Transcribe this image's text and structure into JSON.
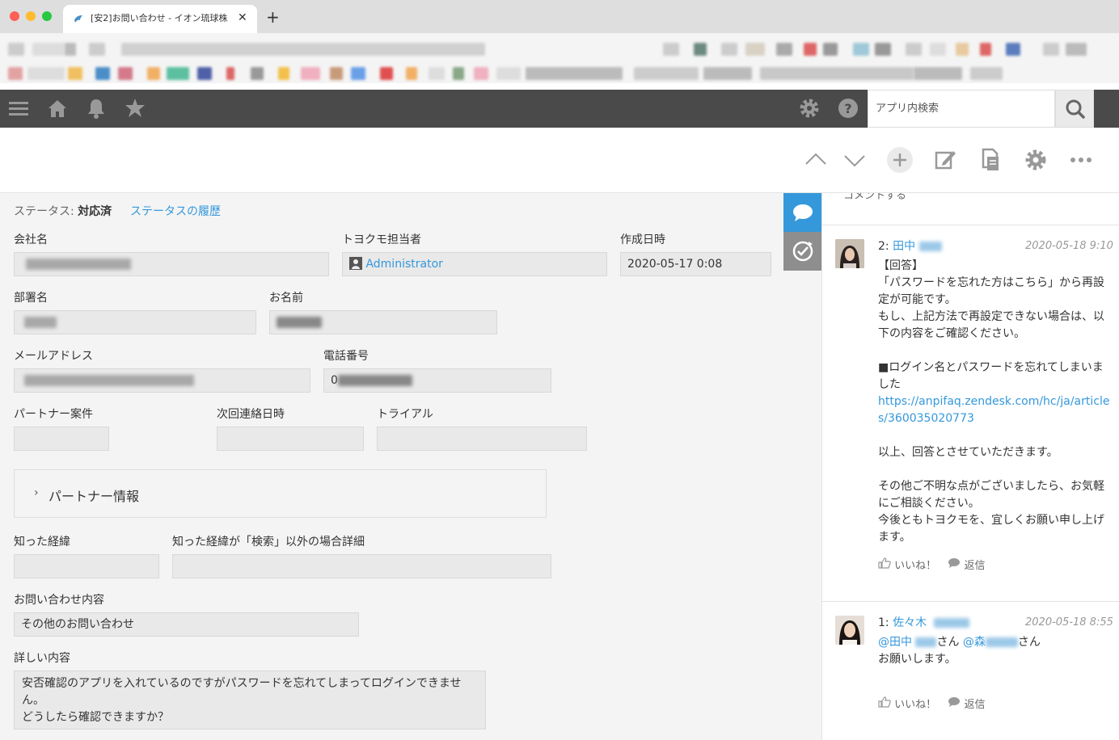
{
  "browser": {
    "tab_title": "[安2]お問い合わせ - イオン琉球株",
    "tab_close": "✕",
    "new_tab": "+"
  },
  "header": {
    "search_placeholder": "アプリ内検索"
  },
  "record": {
    "status_label": "ステータス:",
    "status_value": "対応済",
    "status_history": "ステータスの履歴",
    "fields": {
      "company": {
        "label": "会社名",
        "value": ""
      },
      "owner": {
        "label": "トヨクモ担当者",
        "value": "Administrator"
      },
      "created": {
        "label": "作成日時",
        "value": "2020-05-17 0:08"
      },
      "department": {
        "label": "部署名",
        "value": ""
      },
      "name": {
        "label": "お名前",
        "value": ""
      },
      "email": {
        "label": "メールアドレス",
        "value": ""
      },
      "phone": {
        "label": "電話番号",
        "value": "0"
      },
      "partner_case": {
        "label": "パートナー案件",
        "value": ""
      },
      "next_contact": {
        "label": "次回連絡日時",
        "value": ""
      },
      "trial": {
        "label": "トライアル",
        "value": ""
      },
      "referral": {
        "label": "知った経緯",
        "value": ""
      },
      "referral_detail": {
        "label": "知った経緯が「検索」以外の場合詳細",
        "value": ""
      },
      "inquiry_type": {
        "label": "お問い合わせ内容",
        "value": "その他のお問い合わせ"
      },
      "details": {
        "label": "詳しい内容",
        "lines": [
          "安否確認のアプリを入れているのですがパスワードを忘れてしまってログインできませ",
          "ん。",
          "どうしたら確認できますか？"
        ]
      }
    },
    "partner_group_title": "パートナー情報",
    "partner_group_chevron": "›"
  },
  "comments": {
    "input_placeholder": "コメントする",
    "items": [
      {
        "num": "2:",
        "author": "田中",
        "date": "2020-05-18 9:10",
        "lines": [
          "【回答】",
          "「パスワードを忘れた方はこちら」から再設定が可能です。",
          "もし、上記方法で再設定できない場合は、以下の内容をご確認ください。",
          "",
          "■ログイン名とパスワードを忘れてしまいました"
        ],
        "link": "https://anpifaq.zendesk.com/hc/ja/articles/360035020773",
        "lines_after": [
          "",
          "以上、回答とさせていただきます。",
          "",
          "その他ご不明な点がございましたら、お気軽にご相談ください。",
          "今後ともトヨクモを、宜しくお願い申し上げます。"
        ],
        "like": "いいね！",
        "reply": "返信"
      },
      {
        "num": "1:",
        "author": "佐々木",
        "date": "2020-05-18 8:55",
        "mention1": "@田中",
        "mention1_suffix": "さん",
        "mention2": "@森",
        "mention2_suffix": "さん",
        "line2": "お願いします。",
        "like": "いいね！",
        "reply": "返信"
      }
    ]
  },
  "colors": {
    "header_bg": "#4a4a4a",
    "accent": "#3498db",
    "side_tab_active": "#3498db",
    "side_tab_inactive": "#8e8e8e"
  }
}
